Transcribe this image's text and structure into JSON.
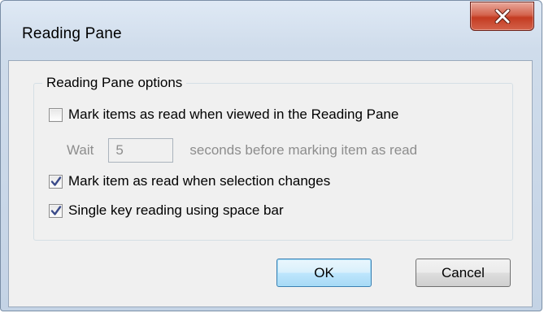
{
  "window": {
    "title": "Reading Pane",
    "close_icon": "close-icon"
  },
  "group": {
    "legend": "Reading Pane options"
  },
  "options": {
    "mark_viewed": {
      "label": "Mark items as read when viewed in the Reading Pane",
      "checked": false
    },
    "wait": {
      "prefix": "Wait",
      "value": "5",
      "suffix": "seconds before marking item as read",
      "enabled": false
    },
    "mark_selection": {
      "label": "Mark item as read when selection changes",
      "checked": true
    },
    "single_key": {
      "label": "Single key reading using space bar",
      "checked": true
    }
  },
  "buttons": {
    "ok": "OK",
    "cancel": "Cancel"
  },
  "colors": {
    "check": "#3a4a8a",
    "disabled_text": "#8d8d8d",
    "close_red": "#c43c22"
  }
}
